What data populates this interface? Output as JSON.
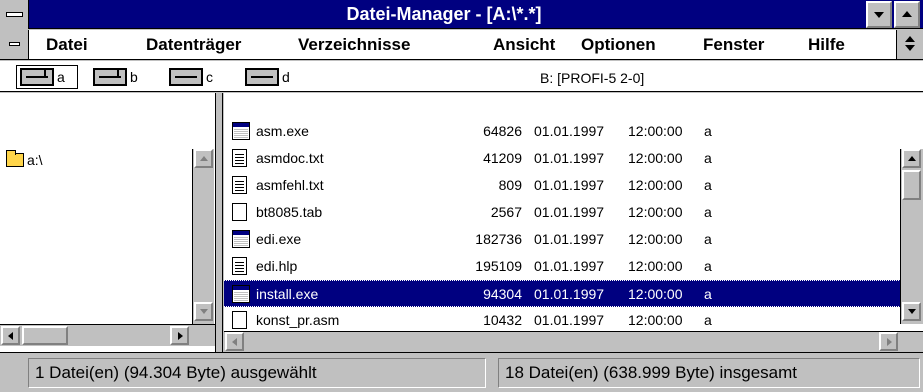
{
  "window": {
    "title": "Datei-Manager - [A:\\*.*]"
  },
  "menu": {
    "items": [
      {
        "label": "Datei"
      },
      {
        "label": "Datenträger"
      },
      {
        "label": "Verzeichnisse"
      },
      {
        "label": "Ansicht"
      },
      {
        "label": "Optionen"
      },
      {
        "label": "Fenster"
      },
      {
        "label": "Hilfe"
      }
    ]
  },
  "drives": {
    "items": [
      {
        "letter": "a",
        "type": "floppy",
        "selected": true
      },
      {
        "letter": "b",
        "type": "floppy",
        "selected": false
      },
      {
        "letter": "c",
        "type": "harddisk",
        "selected": false
      },
      {
        "letter": "d",
        "type": "harddisk",
        "selected": false
      }
    ],
    "volume_label": "B: [PROFI-5 2-0]"
  },
  "tree": {
    "root_label": "a:\\"
  },
  "files": [
    {
      "name": "asm.exe",
      "size": "64826",
      "date": "01.01.1997",
      "time": "12:00:00",
      "attr": "a",
      "icon": "exe-icon"
    },
    {
      "name": "asmdoc.txt",
      "size": "41209",
      "date": "01.01.1997",
      "time": "12:00:00",
      "attr": "a",
      "icon": "document-icon"
    },
    {
      "name": "asmfehl.txt",
      "size": "809",
      "date": "01.01.1997",
      "time": "12:00:00",
      "attr": "a",
      "icon": "document-icon"
    },
    {
      "name": "bt8085.tab",
      "size": "2567",
      "date": "01.01.1997",
      "time": "12:00:00",
      "attr": "a",
      "icon": "file-icon"
    },
    {
      "name": "edi.exe",
      "size": "182736",
      "date": "01.01.1997",
      "time": "12:00:00",
      "attr": "a",
      "icon": "exe-icon"
    },
    {
      "name": "edi.hlp",
      "size": "195109",
      "date": "01.01.1997",
      "time": "12:00:00",
      "attr": "a",
      "icon": "document-icon"
    },
    {
      "name": "install.exe",
      "size": "94304",
      "date": "01.01.1997",
      "time": "12:00:00",
      "attr": "a",
      "icon": "exe-icon"
    },
    {
      "name": "konst_pr.asm",
      "size": "10432",
      "date": "01.01.1997",
      "time": "12:00:00",
      "attr": "a",
      "icon": "file-icon"
    }
  ],
  "selected_file": "install.exe",
  "status": {
    "selected": "1 Datei(en) (94.304 Byte) ausgewählt",
    "total": "18 Datei(en) (638.999 Byte) insgesamt"
  },
  "colors": {
    "titlebar": "#000080",
    "selection": "#000080",
    "chrome": "#c0c0c0"
  }
}
